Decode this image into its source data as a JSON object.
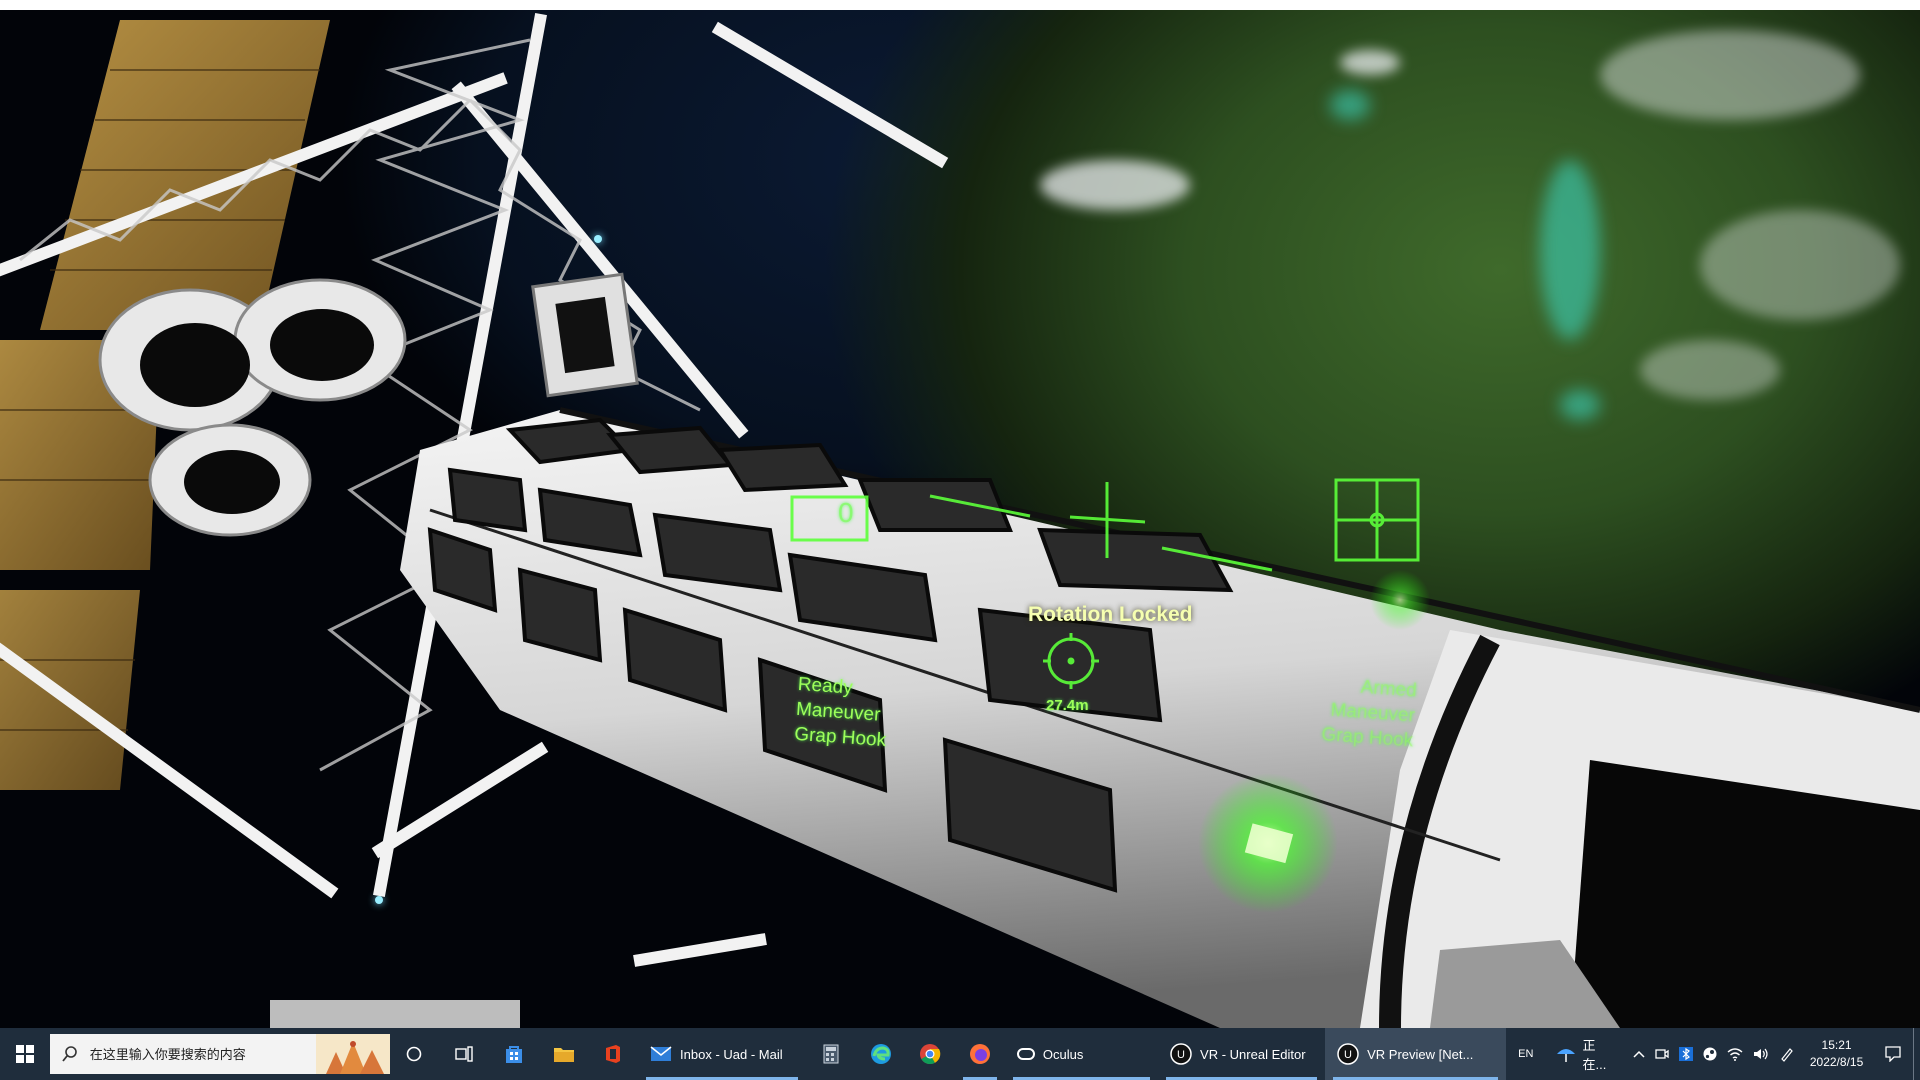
{
  "hud": {
    "status_center": "Rotation Locked",
    "distance": "27.4m",
    "counter": "0",
    "left_panel": [
      "Ready",
      "Maneuver",
      "Grap Hook"
    ],
    "right_panel": [
      "Armed",
      "Maneuver",
      "Grap Hook"
    ]
  },
  "taskbar": {
    "search_placeholder": "在这里输入你要搜索的内容",
    "apps": [
      {
        "name": "mail",
        "label": "Inbox - Uad - Mail"
      },
      {
        "name": "oculus",
        "label": "Oculus"
      },
      {
        "name": "unreal-editor",
        "label": "VR - Unreal Editor"
      },
      {
        "name": "vr-preview",
        "label": "VR Preview [Net..."
      }
    ],
    "tray": {
      "ime": "EN",
      "weather_label": "正在...",
      "time": "15:21",
      "date": "2022/8/15"
    }
  },
  "colors": {
    "hud_green": "#9dff5a",
    "hud_yellow": "#f6ffb0",
    "taskbar_bg": "#1f2d3c",
    "taskbar_active": "#3a4a5c"
  }
}
